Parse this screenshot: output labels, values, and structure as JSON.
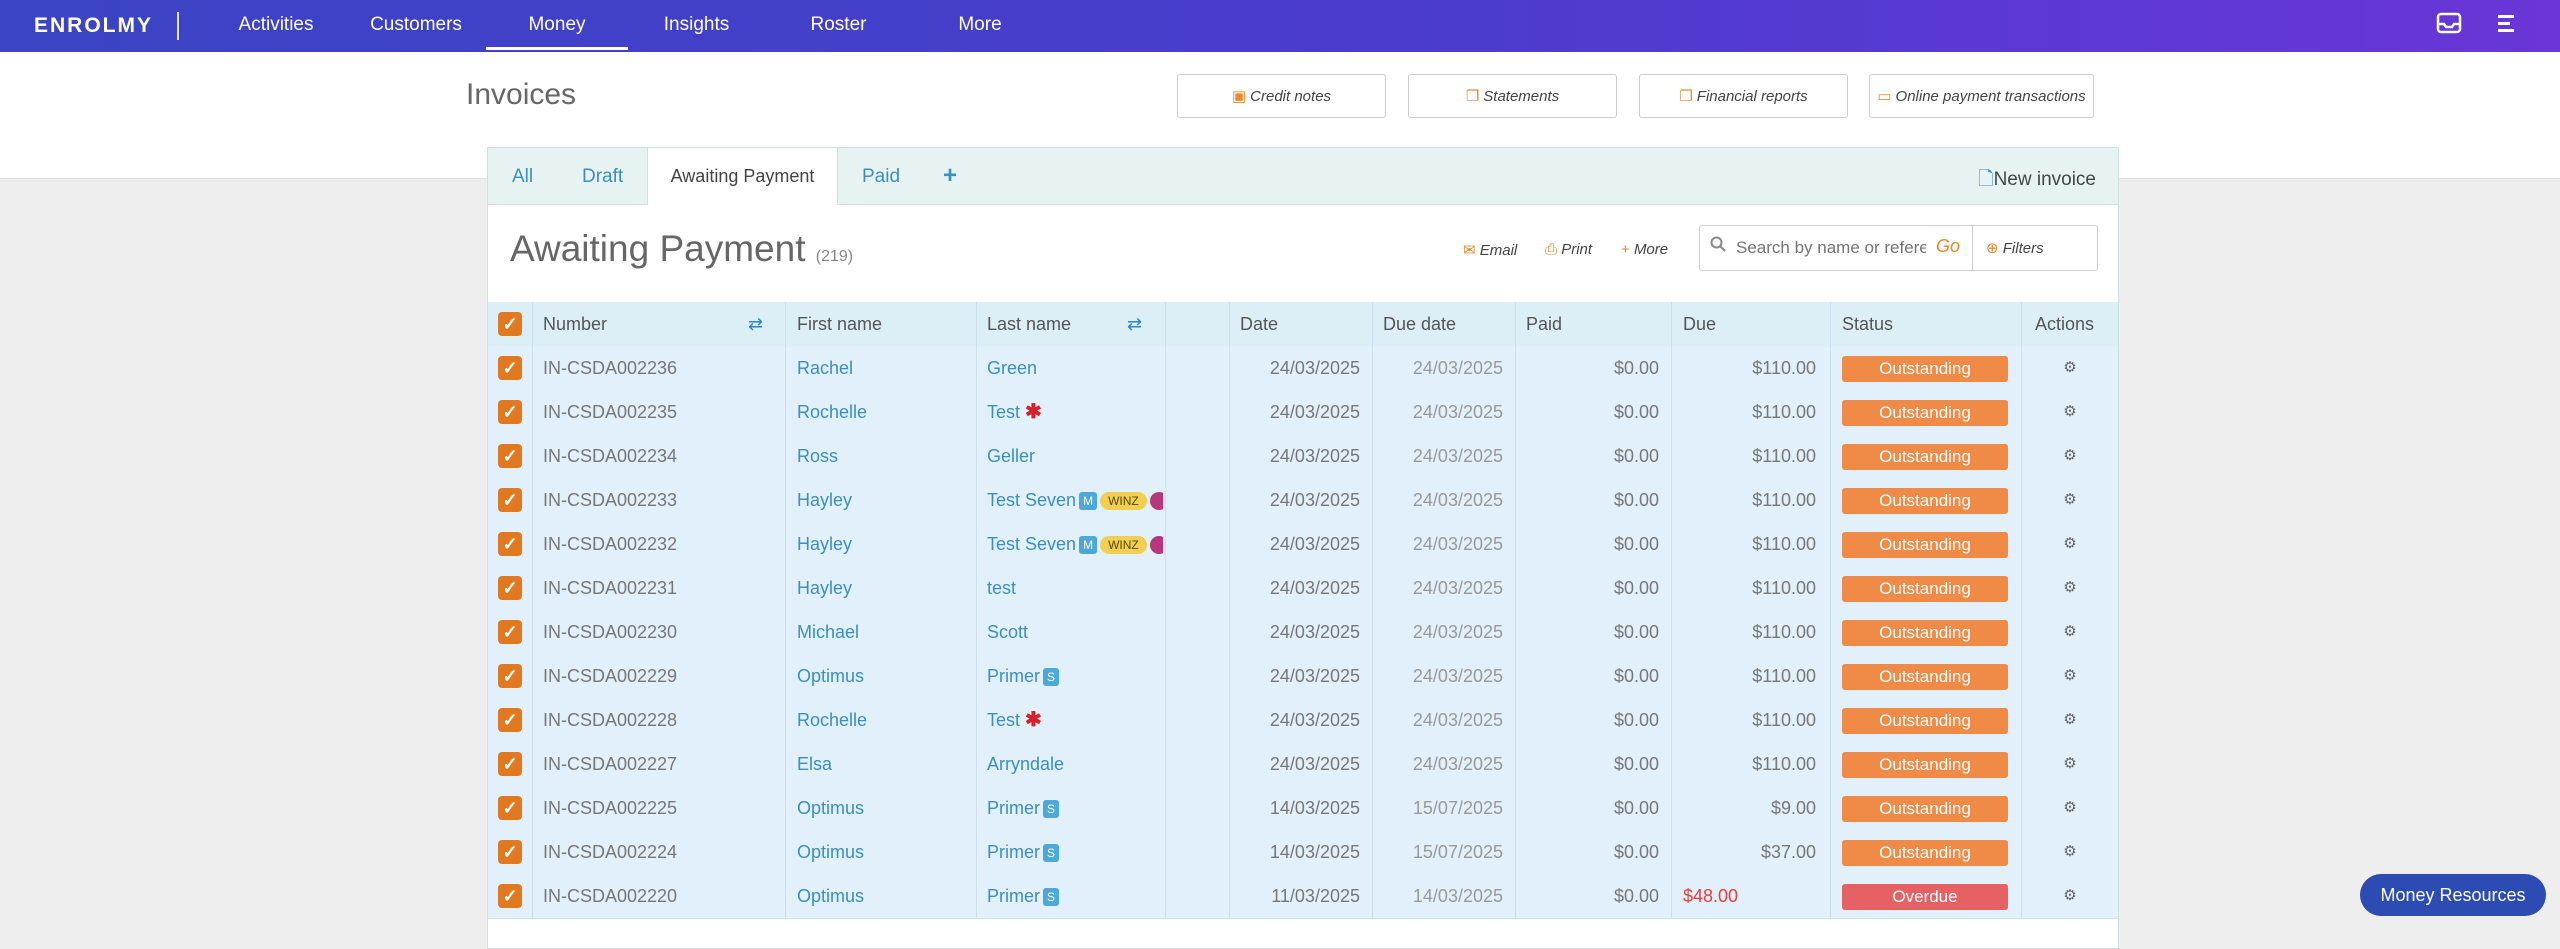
{
  "nav": {
    "logo": "ENROLMY",
    "items": [
      "Activities",
      "Customers",
      "Money",
      "Insights",
      "Roster",
      "More"
    ],
    "active": "Money",
    "icons": [
      "inbox-icon",
      "menu-icon"
    ]
  },
  "header": {
    "title": "Invoices",
    "buttons": [
      "Credit notes",
      "Statements",
      "Financial reports",
      "Online payment transactions"
    ]
  },
  "tabs": {
    "items": [
      "All",
      "Draft",
      "Awaiting Payment",
      "Paid"
    ],
    "active": "Awaiting Payment",
    "new_invoice": "New invoice"
  },
  "section": {
    "title": "Awaiting Payment",
    "count": "(219)",
    "actions": [
      "Email",
      "Print",
      "More"
    ],
    "search_placeholder": "Search by name or reference",
    "search_go": "Go",
    "filters": "Filters"
  },
  "table": {
    "columns": [
      "Number",
      "First name",
      "Last name",
      "Date",
      "Due date",
      "Paid",
      "Due",
      "Status",
      "Actions"
    ],
    "rows": [
      {
        "number": "IN-CSDA002236",
        "first": "Rachel",
        "last": "Green",
        "marks": [],
        "date": "24/03/2025",
        "due_date": "24/03/2025",
        "paid": "$0.00",
        "due": "$110.00",
        "status": "Outstanding"
      },
      {
        "number": "IN-CSDA002235",
        "first": "Rochelle",
        "last": "Test",
        "marks": [
          "star"
        ],
        "date": "24/03/2025",
        "due_date": "24/03/2025",
        "paid": "$0.00",
        "due": "$110.00",
        "status": "Outstanding"
      },
      {
        "number": "IN-CSDA002234",
        "first": "Ross",
        "last": "Geller",
        "marks": [],
        "date": "24/03/2025",
        "due_date": "24/03/2025",
        "paid": "$0.00",
        "due": "$110.00",
        "status": "Outstanding"
      },
      {
        "number": "IN-CSDA002233",
        "first": "Hayley",
        "last": "Test Seven",
        "marks": [
          "M",
          "WINZ",
          "pink"
        ],
        "date": "24/03/2025",
        "due_date": "24/03/2025",
        "paid": "$0.00",
        "due": "$110.00",
        "status": "Outstanding"
      },
      {
        "number": "IN-CSDA002232",
        "first": "Hayley",
        "last": "Test Seven",
        "marks": [
          "M",
          "WINZ",
          "pink"
        ],
        "date": "24/03/2025",
        "due_date": "24/03/2025",
        "paid": "$0.00",
        "due": "$110.00",
        "status": "Outstanding"
      },
      {
        "number": "IN-CSDA002231",
        "first": "Hayley",
        "last": "test",
        "marks": [],
        "date": "24/03/2025",
        "due_date": "24/03/2025",
        "paid": "$0.00",
        "due": "$110.00",
        "status": "Outstanding"
      },
      {
        "number": "IN-CSDA002230",
        "first": "Michael",
        "last": "Scott",
        "marks": [],
        "date": "24/03/2025",
        "due_date": "24/03/2025",
        "paid": "$0.00",
        "due": "$110.00",
        "status": "Outstanding"
      },
      {
        "number": "IN-CSDA002229",
        "first": "Optimus",
        "last": "Primer",
        "marks": [
          "S"
        ],
        "date": "24/03/2025",
        "due_date": "24/03/2025",
        "paid": "$0.00",
        "due": "$110.00",
        "status": "Outstanding"
      },
      {
        "number": "IN-CSDA002228",
        "first": "Rochelle",
        "last": "Test",
        "marks": [
          "star"
        ],
        "date": "24/03/2025",
        "due_date": "24/03/2025",
        "paid": "$0.00",
        "due": "$110.00",
        "status": "Outstanding"
      },
      {
        "number": "IN-CSDA002227",
        "first": "Elsa",
        "last": "Arryndale",
        "marks": [],
        "date": "24/03/2025",
        "due_date": "24/03/2025",
        "paid": "$0.00",
        "due": "$110.00",
        "status": "Outstanding"
      },
      {
        "number": "IN-CSDA002225",
        "first": "Optimus",
        "last": "Primer",
        "marks": [
          "S"
        ],
        "date": "14/03/2025",
        "due_date": "15/07/2025",
        "paid": "$0.00",
        "due": "$9.00",
        "status": "Outstanding"
      },
      {
        "number": "IN-CSDA002224",
        "first": "Optimus",
        "last": "Primer",
        "marks": [
          "S"
        ],
        "date": "14/03/2025",
        "due_date": "15/07/2025",
        "paid": "$0.00",
        "due": "$37.00",
        "status": "Outstanding"
      },
      {
        "number": "IN-CSDA002220",
        "first": "Optimus",
        "last": "Primer",
        "marks": [
          "S"
        ],
        "date": "11/03/2025",
        "due_date": "14/03/2025",
        "paid": "$0.00",
        "due": "$48.00",
        "status": "Overdue"
      }
    ]
  },
  "colors": {
    "outstanding": "#ef8b46",
    "overdue": "#e56163",
    "link": "#3a8fbf",
    "accent": "#e0791f"
  },
  "money_resources": "Money Resources"
}
